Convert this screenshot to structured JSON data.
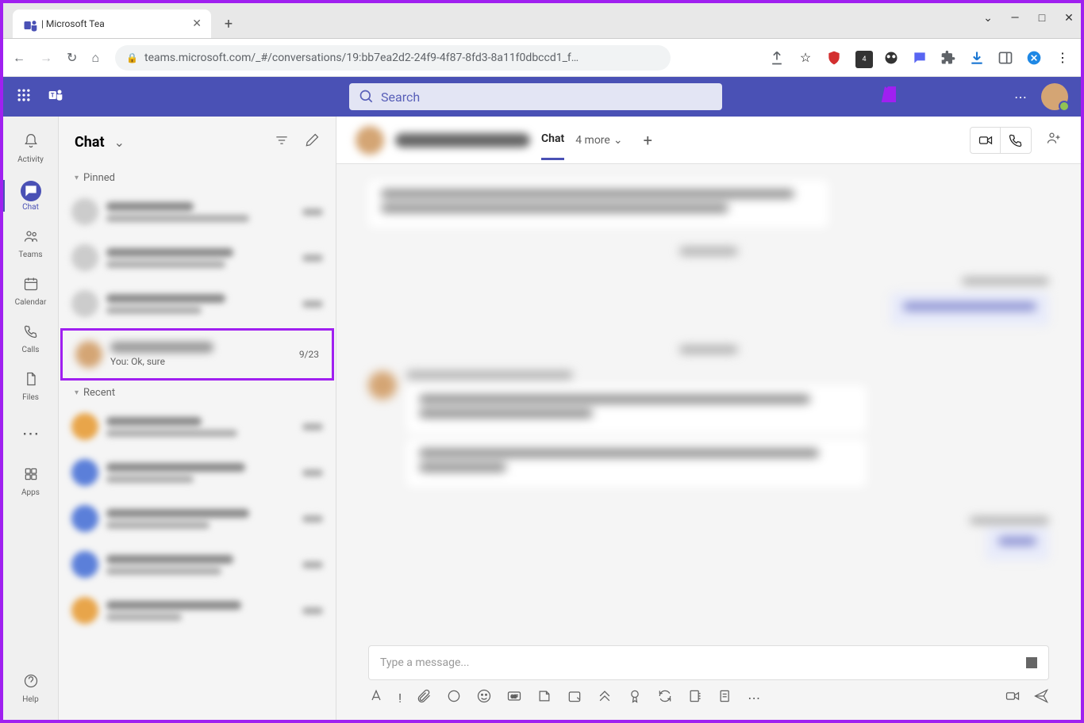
{
  "browser": {
    "tab_title": "| Microsoft Tea",
    "url": "teams.microsoft.com/_#/conversations/19:bb7ea2d2-24f9-4f87-8fd3-8a11f0dbccd1_f…",
    "ext_badge": "4"
  },
  "teams_header": {
    "search_placeholder": "Search"
  },
  "rail": {
    "activity": "Activity",
    "chat": "Chat",
    "teams": "Teams",
    "calendar": "Calendar",
    "calls": "Calls",
    "files": "Files",
    "apps": "Apps",
    "help": "Help"
  },
  "chat_list": {
    "title": "Chat",
    "pinned": "Pinned",
    "recent": "Recent",
    "highlighted": {
      "preview": "You: Ok, sure",
      "date": "9/23"
    }
  },
  "chat_view": {
    "tab_chat": "Chat",
    "more": "4 more"
  },
  "compose": {
    "placeholder": "Type a message..."
  }
}
